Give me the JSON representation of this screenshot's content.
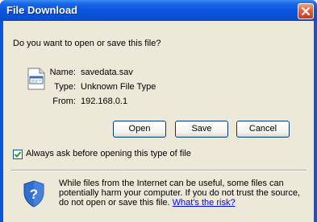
{
  "dialog": {
    "title": "File Download",
    "question": "Do you want to open or save this file?"
  },
  "file_info": {
    "name_label": "Name:",
    "name_value": "savedata.sav",
    "type_label": "Type:",
    "type_value": "Unknown File Type",
    "from_label": "From:",
    "from_value": "192.168.0.1",
    "icon": "generic-file-icon"
  },
  "buttons": {
    "open": "Open",
    "save": "Save",
    "cancel": "Cancel",
    "close_icon": "close-icon"
  },
  "checkbox": {
    "label": "Always ask before opening this type of file",
    "checked": true
  },
  "warning": {
    "text": "While files from the Internet can be useful, some files can potentially harm your computer. If you do not trust the source, do not open or save this file.",
    "link": "What's the risk?",
    "icon": "security-shield-icon"
  },
  "colors": {
    "titlebar": "#0a55df",
    "dialog_bg": "#ece9d8",
    "close_button": "#e06040",
    "link": "#0000ff"
  }
}
